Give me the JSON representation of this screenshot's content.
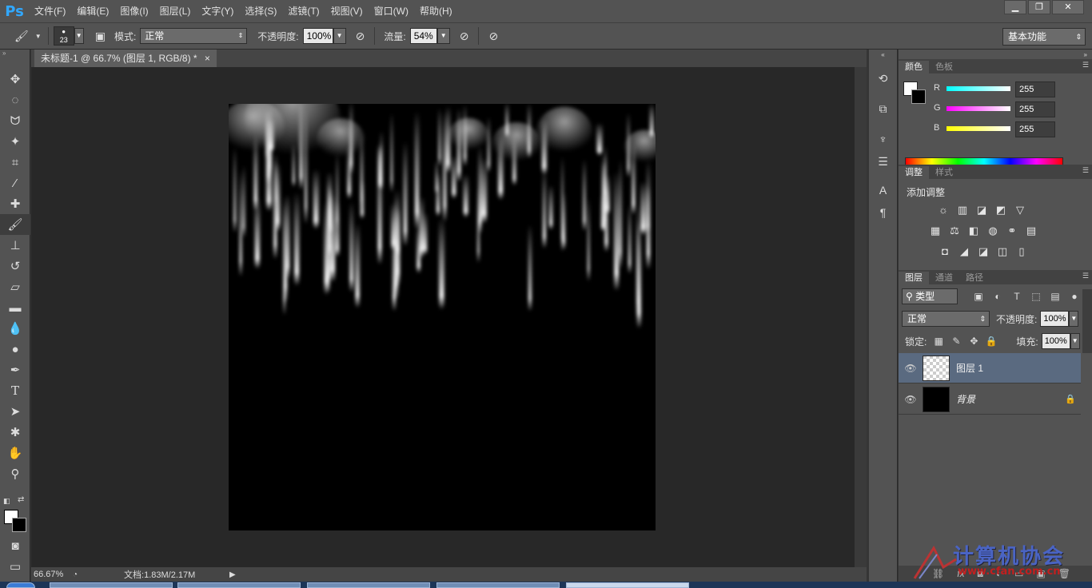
{
  "app": {
    "logo": "Ps",
    "menu": [
      "文件(F)",
      "编辑(E)",
      "图像(I)",
      "图层(L)",
      "文字(Y)",
      "选择(S)",
      "滤镜(T)",
      "视图(V)",
      "窗口(W)",
      "帮助(H)"
    ],
    "window_controls": [
      "▁",
      "❐",
      "✕"
    ]
  },
  "options": {
    "brush_size": "23",
    "mode_label": "模式:",
    "mode_value": "正常",
    "opacity_label": "不透明度:",
    "opacity_value": "100%",
    "flow_label": "流量:",
    "flow_value": "54%",
    "workspace": "基本功能"
  },
  "document": {
    "tab_title": "未标题-1 @ 66.7% (图层 1, RGB/8) *",
    "close": "×"
  },
  "status": {
    "zoom": "66.67%",
    "doc_info": "文档:1.83M/2.17M"
  },
  "color_panel": {
    "tabs": [
      "颜色",
      "色板"
    ],
    "channels": [
      {
        "label": "R",
        "value": "255",
        "color": "#00ffff"
      },
      {
        "label": "G",
        "value": "255",
        "color": "#ff00ff"
      },
      {
        "label": "B",
        "value": "255",
        "color": "#ffff00"
      }
    ],
    "foreground": "#ffffff",
    "background": "#000000"
  },
  "adjustments_panel": {
    "tabs": [
      "调整",
      "样式"
    ],
    "title": "添加调整"
  },
  "layers_panel": {
    "tabs": [
      "图层",
      "通道",
      "路径"
    ],
    "filter": "类型",
    "blend_mode": "正常",
    "opacity_label": "不透明度:",
    "opacity_value": "100%",
    "lock_label": "锁定:",
    "fill_label": "填充:",
    "fill_value": "100%",
    "layers": [
      {
        "name": "图层 1",
        "selected": true
      },
      {
        "name": "背景",
        "locked": true
      }
    ]
  },
  "watermark": {
    "text": "计算机协会",
    "url": "www.cfan.com.cn"
  }
}
